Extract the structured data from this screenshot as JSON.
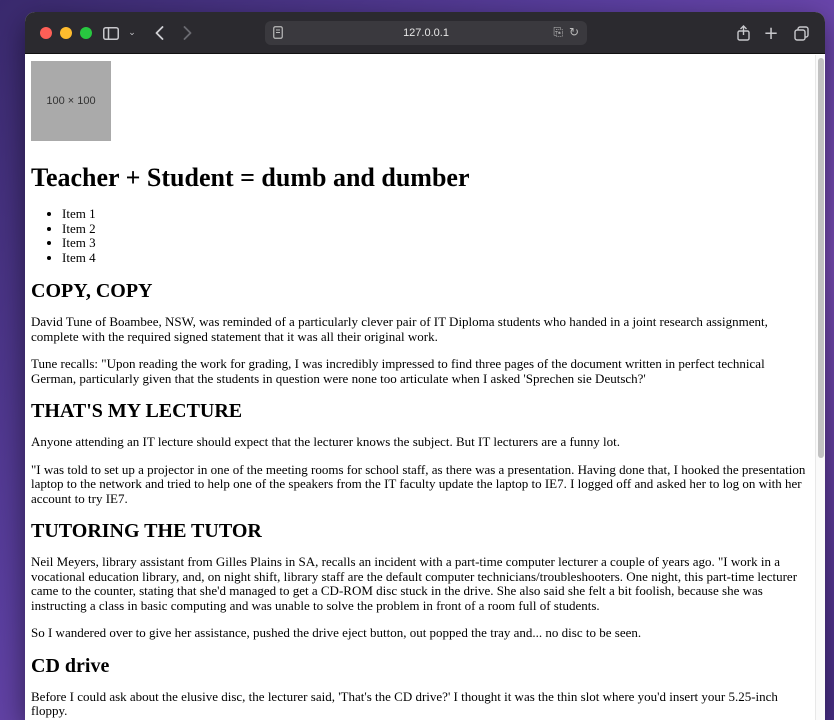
{
  "browser": {
    "url": "127.0.0.1"
  },
  "page": {
    "image_placeholder": "100 × 100",
    "title": "Teacher + Student = dumb and dumber",
    "list_items": [
      "Item 1",
      "Item 2",
      "Item 3",
      "Item 4"
    ],
    "sections": [
      {
        "heading": "COPY, COPY",
        "paragraphs": [
          "David Tune of Boambee, NSW, was reminded of a particularly clever pair of IT Diploma students who handed in a joint research assignment, complete with the required signed statement that it was all their original work.",
          "Tune recalls: \"Upon reading the work for grading, I was incredibly impressed to find three pages of the document written in perfect technical German, particularly given that the students in question were none too articulate when I asked 'Sprechen sie Deutsch?'"
        ]
      },
      {
        "heading": "THAT'S MY LECTURE",
        "paragraphs": [
          "Anyone attending an IT lecture should expect that the lecturer knows the subject. But IT lecturers are a funny lot.",
          "\"I was told to set up a projector in one of the meeting rooms for school staff, as there was a presentation. Having done that, I hooked the presentation laptop to the network and tried to help one of the speakers from the IT faculty update the laptop to IE7. I logged off and asked her to log on with her account to try IE7."
        ]
      },
      {
        "heading": "TUTORING THE TUTOR",
        "paragraphs": [
          "Neil Meyers, library assistant from Gilles Plains in SA, recalls an incident with a part-time computer lecturer a couple of years ago. \"I work in a vocational education library, and, on night shift, library staff are the default computer technicians/troubleshooters. One night, this part-time lecturer came to the counter, stating that she'd managed to get a CD-ROM disc stuck in the drive. She also said she felt a bit foolish, because she was instructing a class in basic computing and was unable to solve the problem in front of a room full of students.",
          "So I wandered over to give her assistance, pushed the drive eject button, out popped the tray and... no disc to be seen."
        ]
      },
      {
        "heading": "CD drive",
        "paragraphs": [
          "Before I could ask about the elusive disc, the lecturer said, 'That's the CD drive?' I thought it was the thin slot where you'd insert your 5.25-inch floppy."
        ]
      }
    ]
  }
}
